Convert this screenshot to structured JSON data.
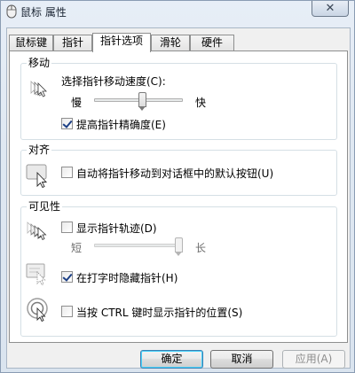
{
  "window": {
    "title": "鼠标 属性",
    "close_glyph": "✕"
  },
  "tabs": [
    {
      "label": "鼠标键",
      "active": false
    },
    {
      "label": "指针",
      "active": false
    },
    {
      "label": "指针选项",
      "active": true
    },
    {
      "label": "滑轮",
      "active": false
    },
    {
      "label": "硬件",
      "active": false
    }
  ],
  "motion": {
    "group_title": "移动",
    "speed_label": "选择指针移动速度(C):",
    "slow_label": "慢",
    "fast_label": "快",
    "speed_value": 0.55,
    "precision_label": "提高指针精确度(E)",
    "precision_checked": true,
    "icon": "pointer-speed-icon"
  },
  "snap": {
    "group_title": "对齐",
    "snap_label": "自动将指针移动到对话框中的默认按钮(U)",
    "snap_checked": false,
    "icon": "snap-to-default-icon"
  },
  "visibility": {
    "group_title": "可见性",
    "trails_label": "显示指针轨迹(D)",
    "trails_checked": false,
    "short_label": "短",
    "long_label": "长",
    "trails_value": 1.0,
    "hide_label": "在打字时隐藏指针(H)",
    "hide_checked": true,
    "ctrl_label": "当按 CTRL 键时显示指针的位置(S)",
    "ctrl_checked": false,
    "icons": [
      "pointer-trails-icon",
      "hide-while-typing-icon",
      "ctrl-locate-icon"
    ]
  },
  "buttons": {
    "ok": "确定",
    "cancel": "取消",
    "apply": "应用(A)"
  },
  "colors": {
    "default_button_border": "#3c7fb1",
    "checkmark": "#1c3f85"
  }
}
